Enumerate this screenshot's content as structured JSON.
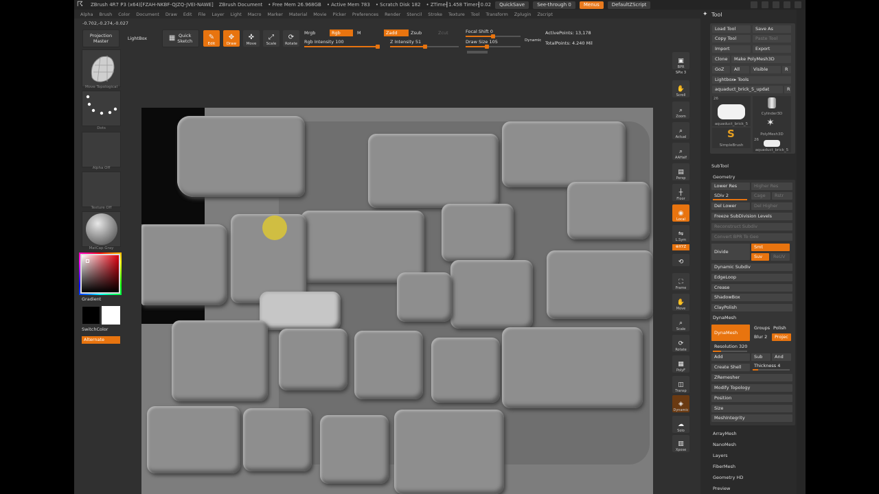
{
  "titlebar": {
    "app": "ZBrush 4R7 P3 (x64)[FZAH-NKBF-QJZQ-JVEI-NAWE]",
    "document": "ZBrush Document",
    "free_mem": "• Free Mem 26.968GB",
    "active_mem": "• Active Mem 783",
    "scratch": "• Scratch Disk 182",
    "ztime": "• ZTime┨1.458 Timer┨0.02",
    "quicksave": "QuickSave",
    "see_through": "See-through  0",
    "menus": "Menus",
    "zscript": "DefaultZScript"
  },
  "menu": [
    "Alpha",
    "Brush",
    "Color",
    "Document",
    "Draw",
    "Edit",
    "File",
    "Layer",
    "Light",
    "Macro",
    "Marker",
    "Material",
    "Movie",
    "Picker",
    "Preferences",
    "Render",
    "Stencil",
    "Stroke",
    "Texture",
    "Tool",
    "Transform",
    "Zplugin",
    "Zscript"
  ],
  "coords": "-0.702,-0.274,-0.027",
  "toolbar": {
    "projection_master": "Projection\nMaster",
    "lightbox": "LightBox",
    "quick_sketch": "Quick\nSketch",
    "edit": "Edit",
    "draw": "Draw",
    "move": "Move",
    "scale": "Scale",
    "rotate": "Rotate",
    "mrgb": "Mrgb",
    "rgb": "Rgb",
    "m": "M",
    "rgb_intensity": "Rgb Intensity 100",
    "zadd": "Zadd",
    "zsub": "Zsub",
    "zcut": "Zcut",
    "z_intensity": "Z Intensity 51",
    "focal_shift": "Focal Shift 0",
    "draw_size": "Draw Size 105",
    "dynamic": "Dynamic",
    "active_points": "ActivePoints: 13,178",
    "total_points": "TotalPoints: 4.240 Mil"
  },
  "left": {
    "brush_label": "Move Topological",
    "stroke_label": "Dots",
    "alpha_label": "Alpha Off",
    "texture_label": "Texture Off",
    "material_label": "MatCap Gray",
    "gradient": "Gradient",
    "switch_color": "SwitchColor",
    "alternate": "Alternate"
  },
  "right": {
    "bpr": "BPR",
    "spix": "SPix 3",
    "scroll": "Scroll",
    "zoom": "Zoom",
    "actual": "Actual",
    "aahalf": "AAHalf",
    "persp": "Persp",
    "floor": "Floor",
    "local": "Local",
    "lsym": "L.Sym",
    "xyz": "⊕XYZ",
    "frame": "Frame",
    "move": "Move",
    "scale": "Scale",
    "rotate": "Rotate",
    "polyf": "PolyF",
    "transp": "Transp",
    "dynamic": "Dynamic",
    "solo": "Solo",
    "xpose": "Xpose"
  },
  "tool": {
    "title": "Tool",
    "load_tool": "Load Tool",
    "save_as": "Save As",
    "copy_tool": "Copy Tool",
    "paste_tool": "Paste Tool",
    "import": "Import",
    "export": "Export",
    "clone": "Clone",
    "make_polymesh": "Make PolyMesh3D",
    "goz": "GoZ",
    "all": "All",
    "visible": "Visible",
    "r": "R",
    "lightbox_tools": "Lightbox▸ Tools",
    "current_tool": "aquaduct_brick_5_updat",
    "cyl": "Cylinder3D",
    "polymesh": "PolyMesh3D",
    "simplebrush": "SimpleBrush",
    "brick_thumb": "aquaduct_brick_5",
    "count26": "26",
    "subtool": "SubTool",
    "geometry": "Geometry",
    "lower_res": "Lower Res",
    "higher_res": "Higher Res",
    "sdiv": "SDiv 2",
    "cage": "Cage",
    "rstr": "Rstr",
    "del_lower": "Del Lower",
    "del_higher": "Del Higher",
    "freeze": "Freeze SubDivision Levels",
    "reconstruct": "Reconstruct Subdiv",
    "convert_bpr": "Convert BPR To Geo",
    "divide": "Divide",
    "smt": "Smt",
    "suv": "Suv",
    "rely": "ReUV",
    "dynamic_subdiv": "Dynamic Subdiv",
    "edgeloop": "EdgeLoop",
    "crease": "Crease",
    "shadowbox": "ShadowBox",
    "claypolish": "ClayPolish",
    "dynamesh_section": "DynaMesh",
    "dynamesh_btn": "DynaMesh",
    "groups": "Groups",
    "polish": "Polish",
    "blur": "Blur 2",
    "project": "Projec",
    "resolution": "Resolution 320",
    "add": "Add",
    "sub": "Sub",
    "and": "And",
    "create_shell": "Create Shell",
    "thickness": "Thickness 4",
    "zremesher": "ZRemesher",
    "modify_topology": "Modify Topology",
    "position": "Position",
    "size": "Size",
    "meshintegrity": "MeshIntegrity",
    "arraymesh": "ArrayMesh",
    "nanomesh": "NanoMesh",
    "layers": "Layers",
    "fibermesh": "FiberMesh",
    "geometry_hd": "Geometry HD",
    "preview": "Preview"
  }
}
